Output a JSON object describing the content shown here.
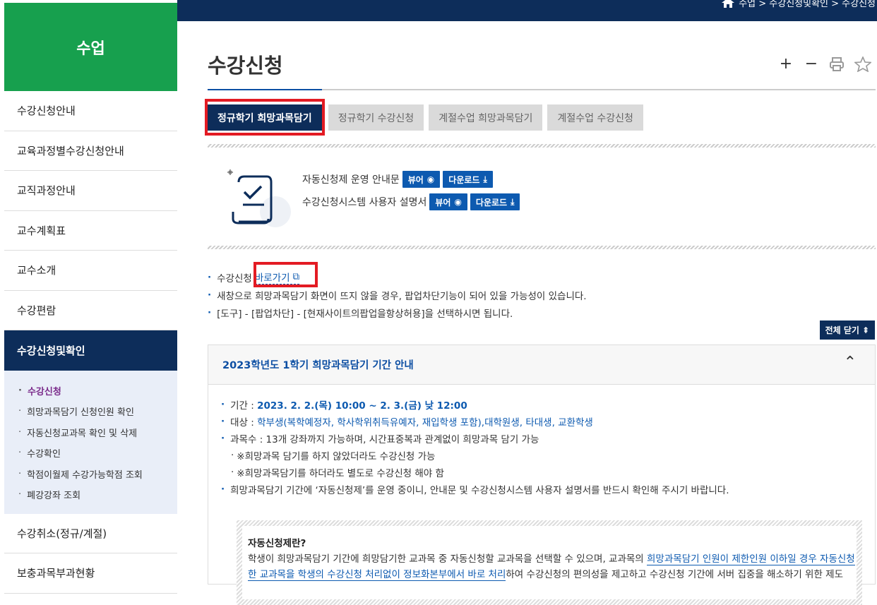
{
  "breadcrumb": {
    "icon": "home-icon",
    "text": "수업 > 수강신청및확인 > 수강신청"
  },
  "sidebar": {
    "heading": "수업",
    "items_top": [
      "수강신청안내",
      "교육과정별수강신청안내",
      "교직과정안내",
      "교수계획표",
      "교수소개",
      "수강편람"
    ],
    "active": "수강신청및확인",
    "sub_items": [
      "수강신청",
      "희망과목담기 신청인원 확인",
      "자동신청교과목 확인 및 삭제",
      "수강확인",
      "학점이월제 수강가능학점 조회",
      "폐강강좌 조회"
    ],
    "items_bottom": [
      "수강취소(정규/계절)",
      "보충과목부과현황"
    ]
  },
  "page": {
    "title": "수강신청"
  },
  "tools": {
    "plus": "+",
    "minus": "−",
    "print": "print-icon",
    "star": "star-icon"
  },
  "tabs": [
    "정규학기 희망과목담기",
    "정규학기 수강신청",
    "계절수업 희망과목담기",
    "계절수업 수강신청"
  ],
  "docs": {
    "row1_label": "자동신청제 운영 안내문",
    "row2_label": "수강신청시스템 사용자 설명서",
    "view": "뷰어",
    "download": "다운로드"
  },
  "notes": {
    "n1_prefix": "수강신청",
    "n1_link": "바로가기",
    "n2": "새창으로 희망과목담기 화면이 뜨지 않을 경우, 팝업차단기능이 되어 있을 가능성이 있습니다.",
    "n3": "[도구] - [팝업차단] - [현재사이트의팝업을항상허용]을 선택하시면 됩니다."
  },
  "close_all": "전체 닫기",
  "accordion": {
    "title": "2023학년도 1학기 희망과목담기 기간 안내",
    "period_label": "기간 :",
    "period_value": "2023. 2. 2.(목) 10:00 ~ 2. 3.(금) 낮 12:00",
    "target_label": "대상 :",
    "target_value": "학부생(복학예정자, 학사학위취득유예자, 재입학생 포함),대학원생, 타대생, 교환학생",
    "count": "과목수 : 13개 강좌까지 가능하며, 시간표중복과 관계없이 희망과목 담기 가능",
    "sub1": "※희망과목 담기를 하지 않았더라도 수강신청 가능",
    "sub2": "※희망과목담기를 하더라도 별도로 수강신청 해야 함",
    "notice": "희망과목담기 기간에 ‘자동신청제’를 운영 중이니, 안내문 및 수강신청시스템 사용자 설명서를 반드시 확인해 주시기 바랍니다."
  },
  "box": {
    "title": "자동신청제란?",
    "text_a": "학생이 희망과목담기 기간에 희망담기한 교과목 중 자동신청할 교과목을 선택할 수 있으며, 교과목의 ",
    "text_hl": "희망과목담기 인원이 제한인원 이하일 경우 자동신청한 교과목을 학생의 수강신청 처리없이 정보화본부에서 바로 처리",
    "text_b": "하여 수강신청의 편의성을 제고하고 수강신청 기간에 서버 집중을 해소하기 위한 제도"
  }
}
